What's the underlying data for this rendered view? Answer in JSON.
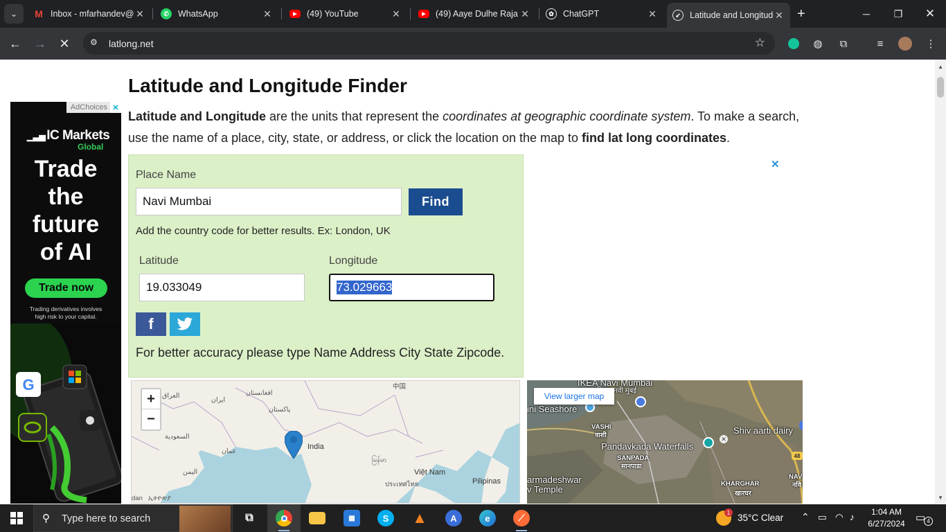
{
  "browser": {
    "tabs": [
      {
        "title": "Inbox - mfarhandev@",
        "icon": "gmail-icon"
      },
      {
        "title": "WhatsApp",
        "icon": "whatsapp-icon"
      },
      {
        "title": "(49) YouTube",
        "icon": "youtube-icon"
      },
      {
        "title": "(49) Aaye Dulhe Raja",
        "icon": "youtube-icon"
      },
      {
        "title": "ChatGPT",
        "icon": "chatgpt-icon"
      },
      {
        "title": "Latitude and Longitude",
        "icon": "compass-icon",
        "active": true
      }
    ],
    "url": "latlong.net"
  },
  "ad_left": {
    "adchoices": "AdChoices",
    "brand": "IC Markets",
    "brand_sub": "Global",
    "headline": [
      "Trade",
      "the",
      "future",
      "of AI"
    ],
    "cta": "Trade now",
    "disclaimer_1": "Trading derivatives involves",
    "disclaimer_2": "high risk to your capital."
  },
  "main": {
    "title": "Latitude and Longitude Finder",
    "intro": {
      "b1": "Latitude and Longitude",
      "t1": " are the units that represent the ",
      "i1": "coordinates at geographic coordinate system",
      "t2": ". To make a search, use the name of a place, city, state, or address, or click the location on the map to ",
      "b2": "find lat long coordinates",
      "t3": "."
    },
    "form": {
      "place_label": "Place Name",
      "place_value": "Navi Mumbai",
      "find_label": "Find",
      "hint": "Add the country code for better results. Ex: London, UK",
      "lat_label": "Latitude",
      "lat_value": "19.033049",
      "lng_label": "Longitude",
      "lng_value": "73.029663",
      "accuracy": "For better accuracy please type Name Address City State Zipcode."
    },
    "ad_right_close": "✕",
    "map": {
      "zoom_in": "+",
      "zoom_out": "−",
      "labels": {
        "china": "中国",
        "iraq": "العراق",
        "iran": "ایران",
        "afghanistan": "افغانستان",
        "pakistan": "پاکستان",
        "saudi": "السعودية",
        "oman": "عمان",
        "yemen": "اليمن",
        "india": "India",
        "myanmar": "မြန်မာ",
        "thailand": "ประเทศไทย",
        "vietnam": "Việt Nam",
        "philippines": "Pilipinas",
        "ethiopia": "ኢትዮጵያ",
        "sudan": "dan"
      }
    },
    "satmap": {
      "view_larger": "View larger map",
      "labels": {
        "ikea": "IKEA Navi Mumbai",
        "ikea_hi": "इकिया, नवी मुंबई",
        "seashore": "ini Seashore",
        "vashi": "VASHI",
        "vashi_hi": "वाशी",
        "shiv": "Shiv aarti dairy",
        "pandavkada": "Pandavkada Waterfalls",
        "sanpada": "SANPADA",
        "sanpada_hi": "सानपाडा",
        "armadeshwar": "armadeshwar",
        "temple": "v Temple",
        "kharghar": "KHARGHAR",
        "kharghar_hi": "खारघर",
        "nav": "NAV",
        "nav_hi": "नवि",
        "road48": "48"
      }
    }
  },
  "taskbar": {
    "search_placeholder": "Type here to search",
    "weather": "35°C  Clear",
    "weather_badge": "1",
    "time": "1:04 AM",
    "date": "6/27/2024",
    "notif_count": "4"
  }
}
